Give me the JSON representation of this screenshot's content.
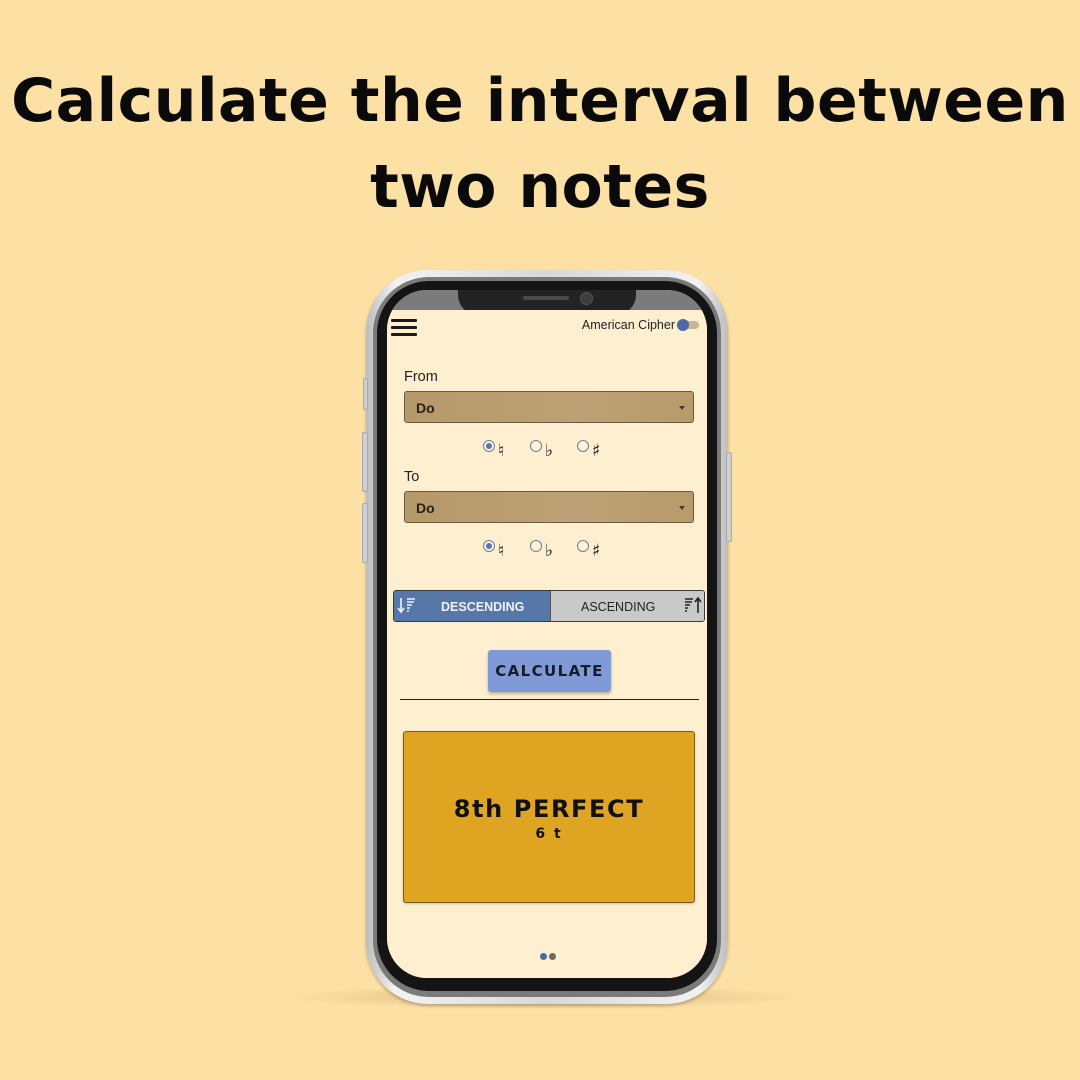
{
  "headline": {
    "line1": "Calculate the interval between",
    "line2": "two notes"
  },
  "app": {
    "header": {
      "menu_icon": "hamburger-menu-icon",
      "cipher_label": "American Cipher",
      "cipher_toggle_on": false
    },
    "from": {
      "label": "From",
      "selected_note": "Do",
      "accidentals": [
        {
          "name": "natural",
          "symbol": "♮",
          "checked": true
        },
        {
          "name": "flat",
          "symbol": "♭",
          "checked": false
        },
        {
          "name": "sharp",
          "symbol": "♯",
          "checked": false
        }
      ]
    },
    "to": {
      "label": "To",
      "selected_note": "Do",
      "accidentals": [
        {
          "name": "natural",
          "symbol": "♮",
          "checked": true
        },
        {
          "name": "flat",
          "symbol": "♭",
          "checked": false
        },
        {
          "name": "sharp",
          "symbol": "♯",
          "checked": false
        }
      ]
    },
    "direction": {
      "options": [
        {
          "label": "DESCENDING",
          "icon": "sort-descending-icon",
          "selected": true
        },
        {
          "label": "ASCENDING",
          "icon": "sort-ascending-icon",
          "selected": false
        }
      ]
    },
    "calculate_label": "CALCULATE",
    "result": {
      "interval": "8th PERFECT",
      "tones": "6 t"
    },
    "pager": {
      "pages": 2,
      "current": 1
    }
  },
  "colors": {
    "background": "#fde0a4",
    "screen": "#fdefcf",
    "select": "#b69969",
    "descending_active": "#5777a8",
    "ascending_inactive": "#c9c9c9",
    "calculate_button": "#7f9ad6",
    "result_card": "#dea422"
  }
}
